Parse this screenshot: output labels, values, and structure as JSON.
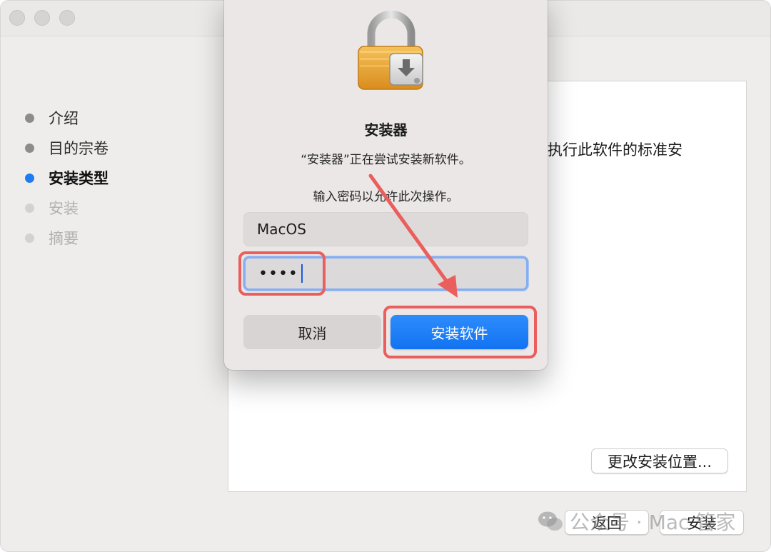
{
  "window": {
    "traffic_lights": [
      "close",
      "minimize",
      "zoom"
    ]
  },
  "sidebar": {
    "steps": [
      {
        "label": "介绍",
        "state": "done"
      },
      {
        "label": "目的宗卷",
        "state": "done"
      },
      {
        "label": "安装类型",
        "state": "active"
      },
      {
        "label": "安装",
        "state": "pending"
      },
      {
        "label": "摘要",
        "state": "pending"
      }
    ]
  },
  "content": {
    "text_fragment": "执行此软件的标准安",
    "change_location_button": "更改安装位置...",
    "back_button": "返回",
    "install_button": "安装"
  },
  "dialog": {
    "icon": "lock-installer-icon",
    "title": "安装器",
    "message": "“安装器”正在尝试安装新软件。",
    "prompt": "输入密码以允许此次操作。",
    "username_value": "MacOS",
    "password_masked": "••••",
    "cancel_label": "取消",
    "confirm_label": "安装软件"
  },
  "watermark": {
    "text": "公众号 · Mac 管家"
  },
  "colors": {
    "accent": "#1d7cf2",
    "annotation": "#ea5e5c"
  }
}
